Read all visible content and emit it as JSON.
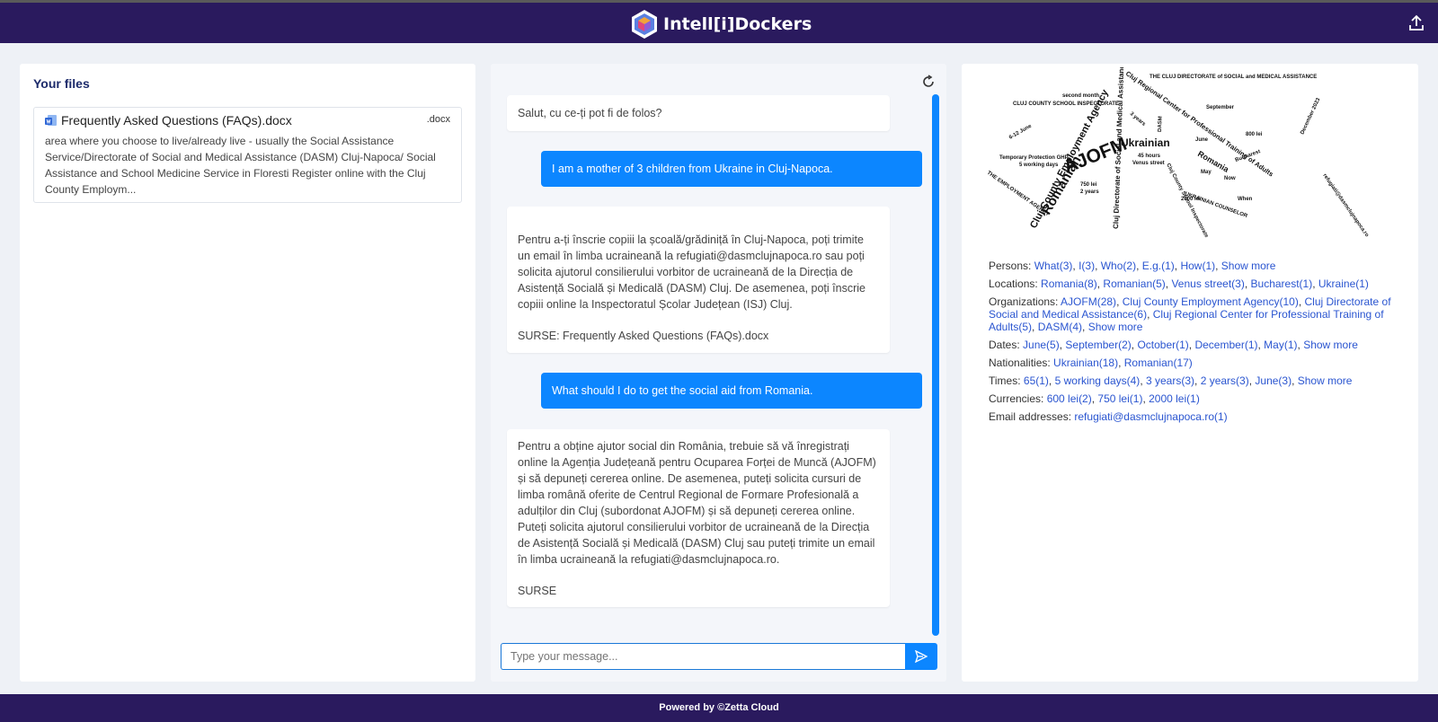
{
  "header": {
    "brand": "Intell[i]Dockers"
  },
  "files_panel": {
    "title": "Your files",
    "files": [
      {
        "name": "Frequently Asked Questions (FAQs).docx",
        "ext": ".docx",
        "snippet": "area where you choose to live/already live - usually the Social Assistance Service/Directorate of Social and Medical Assistance (DASM) Cluj-Napoca/ Social Assistance and School Medicine Service in Floresti Register online with the Cluj County Employm..."
      }
    ]
  },
  "chat": {
    "messages": [
      {
        "role": "bot",
        "text": "Salut, cu ce-ți pot fi de folos?"
      },
      {
        "role": "user",
        "text": "I am a mother of 3 children from Ukraine in Cluj-Napoca."
      },
      {
        "role": "bot",
        "text": "Pentru a-ți înscrie copiii la școală/grădiniță în Cluj-Napoca, poți trimite un email în limba ucraineană la refugiati@dasmclujnapoca.ro sau poți solicita ajutorul consilierului vorbitor de ucraineană de la Direcția de Asistență Socială și Medicală (DASM) Cluj. De asemenea, poți înscrie copiii online la Inspectoratul Școlar Județean (ISJ) Cluj.",
        "sources": "SURSE: Frequently Asked Questions (FAQs).docx"
      },
      {
        "role": "user",
        "text": "What should I do to get the social aid from Romania."
      },
      {
        "role": "bot",
        "text": "Pentru a obține ajutor social din România, trebuie să vă înregistrați online la Agenția Județeană pentru Ocuparea Forței de Muncă (AJOFM) și să depuneți cererea online. De asemenea, puteți solicita cursuri de limba română oferite de Centrul Regional de Formare Profesională a adulților din Cluj (subordonat AJOFM) și să depuneți cererea online. Puteți solicita ajutorul consilierului vorbitor de ucraineană de la Direcția de Asistență Socială și Medicală (DASM) Cluj sau puteți trimite un email în limba ucraineană la refugiati@dasmclujnapoca.ro.",
        "sources": "SURSE"
      }
    ],
    "input_placeholder": "Type your message..."
  },
  "wordcloud_words": [
    "AJOFM",
    "Romanian",
    "Ukrainian",
    "Cluj County Employment Agency",
    "Cluj Directorate of Social and Medical Assistance",
    "Cluj Regional Center for Professional Training of Adults",
    "THE CLUJ DIRECTORATE of SOCIAL and MEDICAL ASSISTANCE",
    "CLUJ COUNTY SCHOOL INSPECTORATE",
    "THE EMPLOYMENT AGENCY",
    "Temporary Protection GHP",
    "5 working days",
    "second month",
    "September",
    "December 2023",
    "Romania",
    "Bucharest",
    "Venus street",
    "45 hours",
    "750 lei",
    "2000 lei",
    "800 lei",
    "2 years",
    "3 years",
    "June",
    "May",
    "Now",
    "When",
    "6-12 June",
    "DASM",
    "UKRAINIAN COUNSELOR",
    "Cluj County School Inspectorate",
    "refugiati@dasmclujnapoca.ro"
  ],
  "entities": [
    {
      "label": "Persons:",
      "values": [
        "What(3)",
        "I(3)",
        "Who(2)",
        "E.g.(1)",
        "How(1)"
      ],
      "more": "Show more"
    },
    {
      "label": "Locations:",
      "values": [
        "Romania(8)",
        "Romanian(5)",
        "Venus street(3)",
        "Bucharest(1)",
        "Ukraine(1)"
      ],
      "more": ""
    },
    {
      "label": "Organizations:",
      "values": [
        "AJOFM(28)",
        "Cluj County Employment Agency(10)",
        "Cluj Directorate of Social and Medical Assistance(6)",
        "Cluj Regional Center for Professional Training of Adults(5)",
        "DASM(4)"
      ],
      "more": "Show more"
    },
    {
      "label": "Dates:",
      "values": [
        "June(5)",
        "September(2)",
        "October(1)",
        "December(1)",
        "May(1)"
      ],
      "more": "Show more"
    },
    {
      "label": "Nationalities:",
      "values": [
        "Ukrainian(18)",
        "Romanian(17)"
      ],
      "more": ""
    },
    {
      "label": "Times:",
      "values": [
        "65(1)",
        "5 working days(4)",
        "3 years(3)",
        "2 years(3)",
        "June(3)"
      ],
      "more": "Show more"
    },
    {
      "label": "Currencies:",
      "values": [
        "600 lei(2)",
        "750 lei(1)",
        "2000 lei(1)"
      ],
      "more": ""
    },
    {
      "label": "Email addresses:",
      "values": [
        "refugiati@dasmclujnapoca.ro(1)"
      ],
      "more": ""
    }
  ],
  "footer": {
    "text": "Powered by ©Zetta Cloud"
  },
  "colors": {
    "header_bg": "#2a1a5e",
    "accent": "#0c86ff",
    "link": "#2a55d0"
  },
  "icons": {
    "upload": "upload-icon",
    "refresh": "refresh-icon",
    "send": "send-icon",
    "document": "document-icon"
  }
}
